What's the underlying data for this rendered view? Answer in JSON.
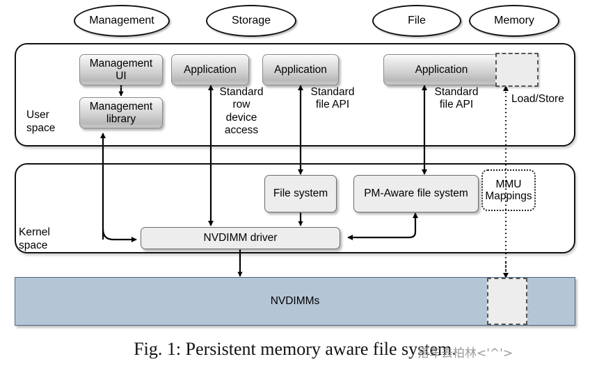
{
  "figure": {
    "caption": "Fig. 1: Persistent memory aware file system.",
    "watermark": "搭车去柏林<'^'>"
  },
  "categories": [
    {
      "label": "Management"
    },
    {
      "label": "Storage"
    },
    {
      "label": "File"
    },
    {
      "label": "Memory"
    }
  ],
  "layers": {
    "user_space": {
      "label": "User\nspace"
    },
    "kernel_space": {
      "label": "Kernel\nspace"
    }
  },
  "user_space_nodes": [
    {
      "label": "Management\nUI"
    },
    {
      "label": "Management\nlibrary"
    },
    {
      "label": "Application"
    },
    {
      "label": "Application"
    },
    {
      "label": "Application"
    }
  ],
  "kernel_space_nodes": [
    {
      "label": "File system"
    },
    {
      "label": "PM-Aware file system"
    },
    {
      "label": "NVDIMM driver"
    },
    {
      "label": "MMU\nMappings"
    }
  ],
  "hardware": {
    "label": "NVDIMMs"
  },
  "arrow_labels": [
    {
      "label": "Standard\nrow\ndevice\naccess"
    },
    {
      "label": "Standard\nfile API"
    },
    {
      "label": "Standard\nfile API"
    },
    {
      "label": "Load/Store"
    }
  ],
  "colors": {
    "nvdimm_fill": "#b4c6d6",
    "nvdimm_stroke": "#4a6480",
    "box_fill_kernel": "#ededed",
    "dashed_fill": "#ececec",
    "stroke": "#111111",
    "watermark": "#9a9a9a"
  }
}
